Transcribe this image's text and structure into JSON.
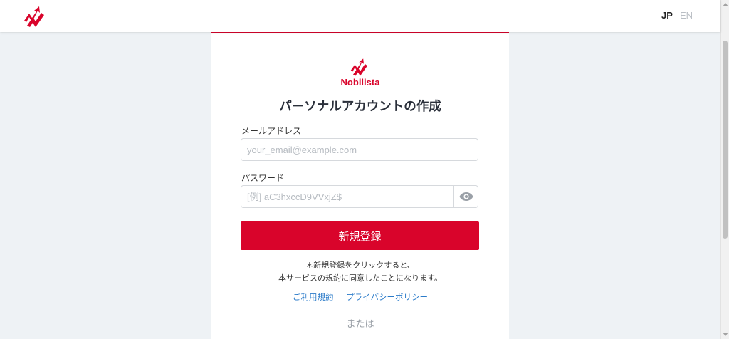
{
  "header": {
    "lang_jp": "JP",
    "lang_en": "EN",
    "logo_icon": "nobilista-logo-icon"
  },
  "card": {
    "brand_name": "Nobilista",
    "title": "パーソナルアカウントの作成",
    "email": {
      "label": "メールアドレス",
      "placeholder": "your_email@example.com",
      "value": ""
    },
    "password": {
      "label": "パスワード",
      "placeholder": "[例] aC3hxccD9VVxjZ$",
      "value": "",
      "toggle_icon": "eye-icon"
    },
    "submit_label": "新規登録",
    "notice_line1": "＊新規登録をクリックすると、",
    "notice_line2": "本サービスの規約に同意したことになります。",
    "terms_link": "ご利用規約",
    "privacy_link": "プライバシーポリシー",
    "divider_text": "または"
  },
  "colors": {
    "brand_red": "#d9042b",
    "link_blue": "#2b7bc9",
    "background": "#eef2f5"
  }
}
